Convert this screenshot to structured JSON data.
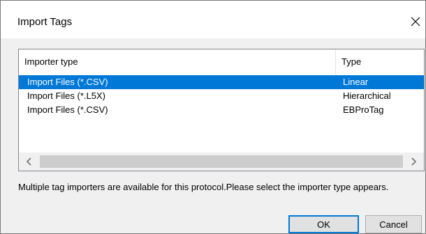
{
  "window": {
    "title": "Import Tags",
    "close_icon": "close-icon"
  },
  "list": {
    "columns": [
      "Importer type",
      "Type"
    ],
    "rows": [
      {
        "importer": "Import Files (*.CSV)",
        "type": "Linear",
        "selected": true
      },
      {
        "importer": "Import Files (*.L5X)",
        "type": "Hierarchical",
        "selected": false
      },
      {
        "importer": "Import Files (*.CSV)",
        "type": "EBProTag",
        "selected": false
      }
    ],
    "scroll_left_icon": "chevron-left-icon",
    "scroll_right_icon": "chevron-right-icon"
  },
  "message": "Multiple tag importers are available for this protocol.Please select the importer type appears.",
  "buttons": {
    "ok": "OK",
    "cancel": "Cancel"
  },
  "colors": {
    "selection": "#0078d7",
    "dialog_bg": "#f0f0f0"
  }
}
